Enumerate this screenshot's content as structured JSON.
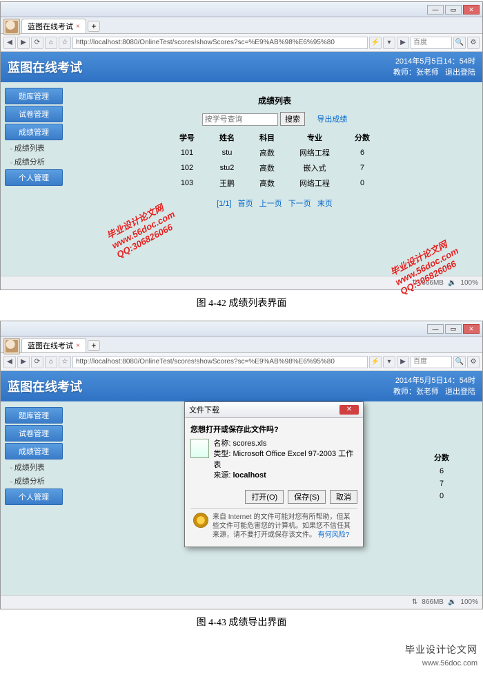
{
  "browser": {
    "tab_title": "蓝图在线考试",
    "url": "http://localhost:8080/OnlineTest/scores!showScores?sc=%E9%AB%98%E6%95%80",
    "search_placeholder": "百度",
    "win_min": "—",
    "win_max": "▭",
    "win_close": "✕",
    "add_tab": "+",
    "tab_close": "×",
    "nav_back": "◀",
    "nav_fwd": "▶",
    "nav_reload": "⟳",
    "nav_home": "⌂",
    "nav_star": "☆",
    "bolt": "⚡",
    "dd": "▾",
    "play": "▶",
    "mag": "🔍",
    "gear": "⚙",
    "status_mem": "866MB",
    "status_zoom": "100%",
    "status_net": "⇅",
    "status_snd": "🔉"
  },
  "app": {
    "title": "蓝图在线考试",
    "datetime": "2014年5月5日14：54时",
    "teacher_label": "教师：",
    "teacher_name": "张老师",
    "logout": "退出登陆"
  },
  "sidebar": {
    "items": [
      "题库管理",
      "试卷管理",
      "成绩管理"
    ],
    "subs": [
      "成绩列表",
      "成绩分析"
    ],
    "last": "个人管理"
  },
  "content": {
    "heading": "成绩列表",
    "search_placeholder": "按学号查询",
    "search_btn": "搜索",
    "export_link": "导出成绩",
    "columns": [
      "学号",
      "姓名",
      "科目",
      "专业",
      "分数"
    ],
    "rows": [
      {
        "id": "101",
        "name": "stu",
        "subject": "高数",
        "major": "网络工程",
        "score": "6"
      },
      {
        "id": "102",
        "name": "stu2",
        "subject": "高数",
        "major": "嵌入式",
        "score": "7"
      },
      {
        "id": "103",
        "name": "王鹏",
        "subject": "高数",
        "major": "网络工程",
        "score": "0"
      }
    ],
    "pager_index": "[1/1]",
    "pager_links": [
      "首页",
      "上一页",
      "下一页",
      "末页"
    ]
  },
  "dialog": {
    "title": "文件下载",
    "question": "您想打开或保存此文件吗?",
    "name_label": "名称:",
    "name_value": "scores.xls",
    "type_label": "类型:",
    "type_value": "Microsoft Office Excel 97-2003 工作表",
    "from_label": "来源:",
    "from_value": "localhost",
    "btn_open": "打开(O)",
    "btn_save": "保存(S)",
    "btn_cancel": "取消",
    "warn_text": "来自 Internet 的文件可能对您有所帮助，但某些文件可能危害您的计算机。如果您不信任其来源，请不要打开或保存该文件。",
    "warn_link": "有何风险?"
  },
  "captions": {
    "c1": "图 4-42  成绩列表界面",
    "c2": "图 4-43  成绩导出界面"
  },
  "watermark": {
    "line1": "毕业设计论文网",
    "line2": "www.56doc.com",
    "line3": "QQ:306826066",
    "footer_cn": "毕业设计论文网",
    "footer_en": "www.56doc.com"
  }
}
